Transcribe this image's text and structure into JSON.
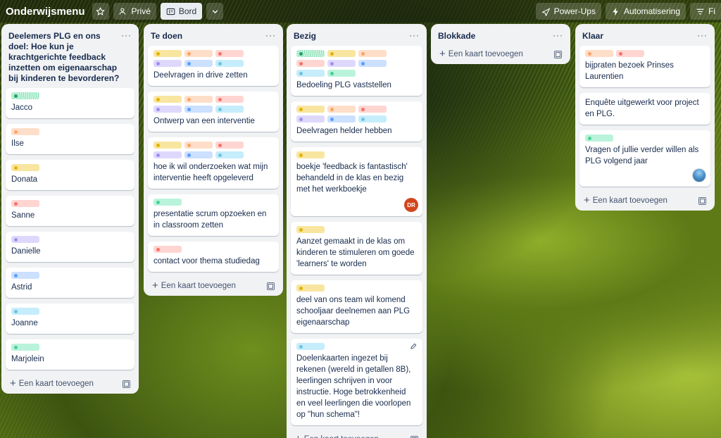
{
  "header": {
    "board_title": "Onderwijsmenu",
    "visibility_label": "Privé",
    "view_label": "Bord",
    "powerups_label": "Power-Ups",
    "automation_label": "Automatisering",
    "filter_label": "Fi"
  },
  "add_card_label": "Een kaart toevoegen",
  "lists": [
    {
      "title": "Deelemers PLG en ons doel: Hoe kun je krachtgerichte feedback inzetten om eigenaarschap bij kinderen te bevorderen?",
      "cards": [
        {
          "labels": [
            "green-dot"
          ],
          "text": "Jacco"
        },
        {
          "labels": [
            "orange"
          ],
          "text": "Ilse"
        },
        {
          "labels": [
            "yellow"
          ],
          "text": "Donata"
        },
        {
          "labels": [
            "red"
          ],
          "text": "Sanne"
        },
        {
          "labels": [
            "purple"
          ],
          "text": "Danielle"
        },
        {
          "labels": [
            "blue"
          ],
          "text": "Astrid"
        },
        {
          "labels": [
            "sky"
          ],
          "text": "Joanne"
        },
        {
          "labels": [
            "green"
          ],
          "text": "Marjolein"
        }
      ]
    },
    {
      "title": "Te doen",
      "cards": [
        {
          "labels": [
            "yellow",
            "orange",
            "red",
            "purple",
            "blue",
            "sky"
          ],
          "text": "Deelvragen in drive zetten"
        },
        {
          "labels": [
            "yellow",
            "orange",
            "red",
            "purple",
            "blue",
            "sky"
          ],
          "text": "Ontwerp van een interventie"
        },
        {
          "labels": [
            "yellow",
            "orange",
            "red",
            "purple",
            "blue",
            "sky"
          ],
          "text": "hoe ik wil onderzoeken wat mijn interventie heeft opgeleverd"
        },
        {
          "labels": [
            "green"
          ],
          "text": "presentatie scrum opzoeken en in classroom zetten"
        },
        {
          "labels": [
            "red"
          ],
          "text": "contact voor thema studiedag"
        }
      ]
    },
    {
      "title": "Bezig",
      "cards": [
        {
          "labels": [
            "green-dot",
            "yellow",
            "orange",
            "red",
            "purple",
            "blue",
            "sky",
            "green"
          ],
          "text": "Bedoeling PLG vaststellen"
        },
        {
          "labels": [
            "yellow",
            "orange",
            "red",
            "purple",
            "blue",
            "sky"
          ],
          "text": "Deelvragen helder hebben"
        },
        {
          "labels": [
            "yellow"
          ],
          "text": "boekje 'feedback is fantastisch' behandeld in de klas en bezig met het werkboekje",
          "avatar": "DR"
        },
        {
          "labels": [
            "yellow"
          ],
          "text": "Aanzet gemaakt in de klas om kinderen te stimuleren om goede 'learners' te worden"
        },
        {
          "labels": [
            "yellow"
          ],
          "text": "deel van ons team wil komend schooljaar deelnemen aan PLG eigenaarschap"
        },
        {
          "labels": [
            "sky"
          ],
          "text": "Doelenkaarten ingezet bij rekenen (wereld in getallen 8B), leerlingen schrijven in voor instructie. Hoge betrokkenheid en veel leerlingen die voorlopen op \"hun schema\"!"
        }
      ]
    },
    {
      "title": "Blokkade",
      "cards": []
    },
    {
      "title": "Klaar",
      "cards": [
        {
          "labels": [
            "orange",
            "red"
          ],
          "text": "bijpraten bezoek Prinses Laurentien"
        },
        {
          "labels": [],
          "text": "Enquête uitgewerkt voor project en PLG."
        },
        {
          "labels": [
            "green"
          ],
          "text": "Vragen of jullie verder willen als PLG volgend jaar"
        }
      ]
    }
  ]
}
